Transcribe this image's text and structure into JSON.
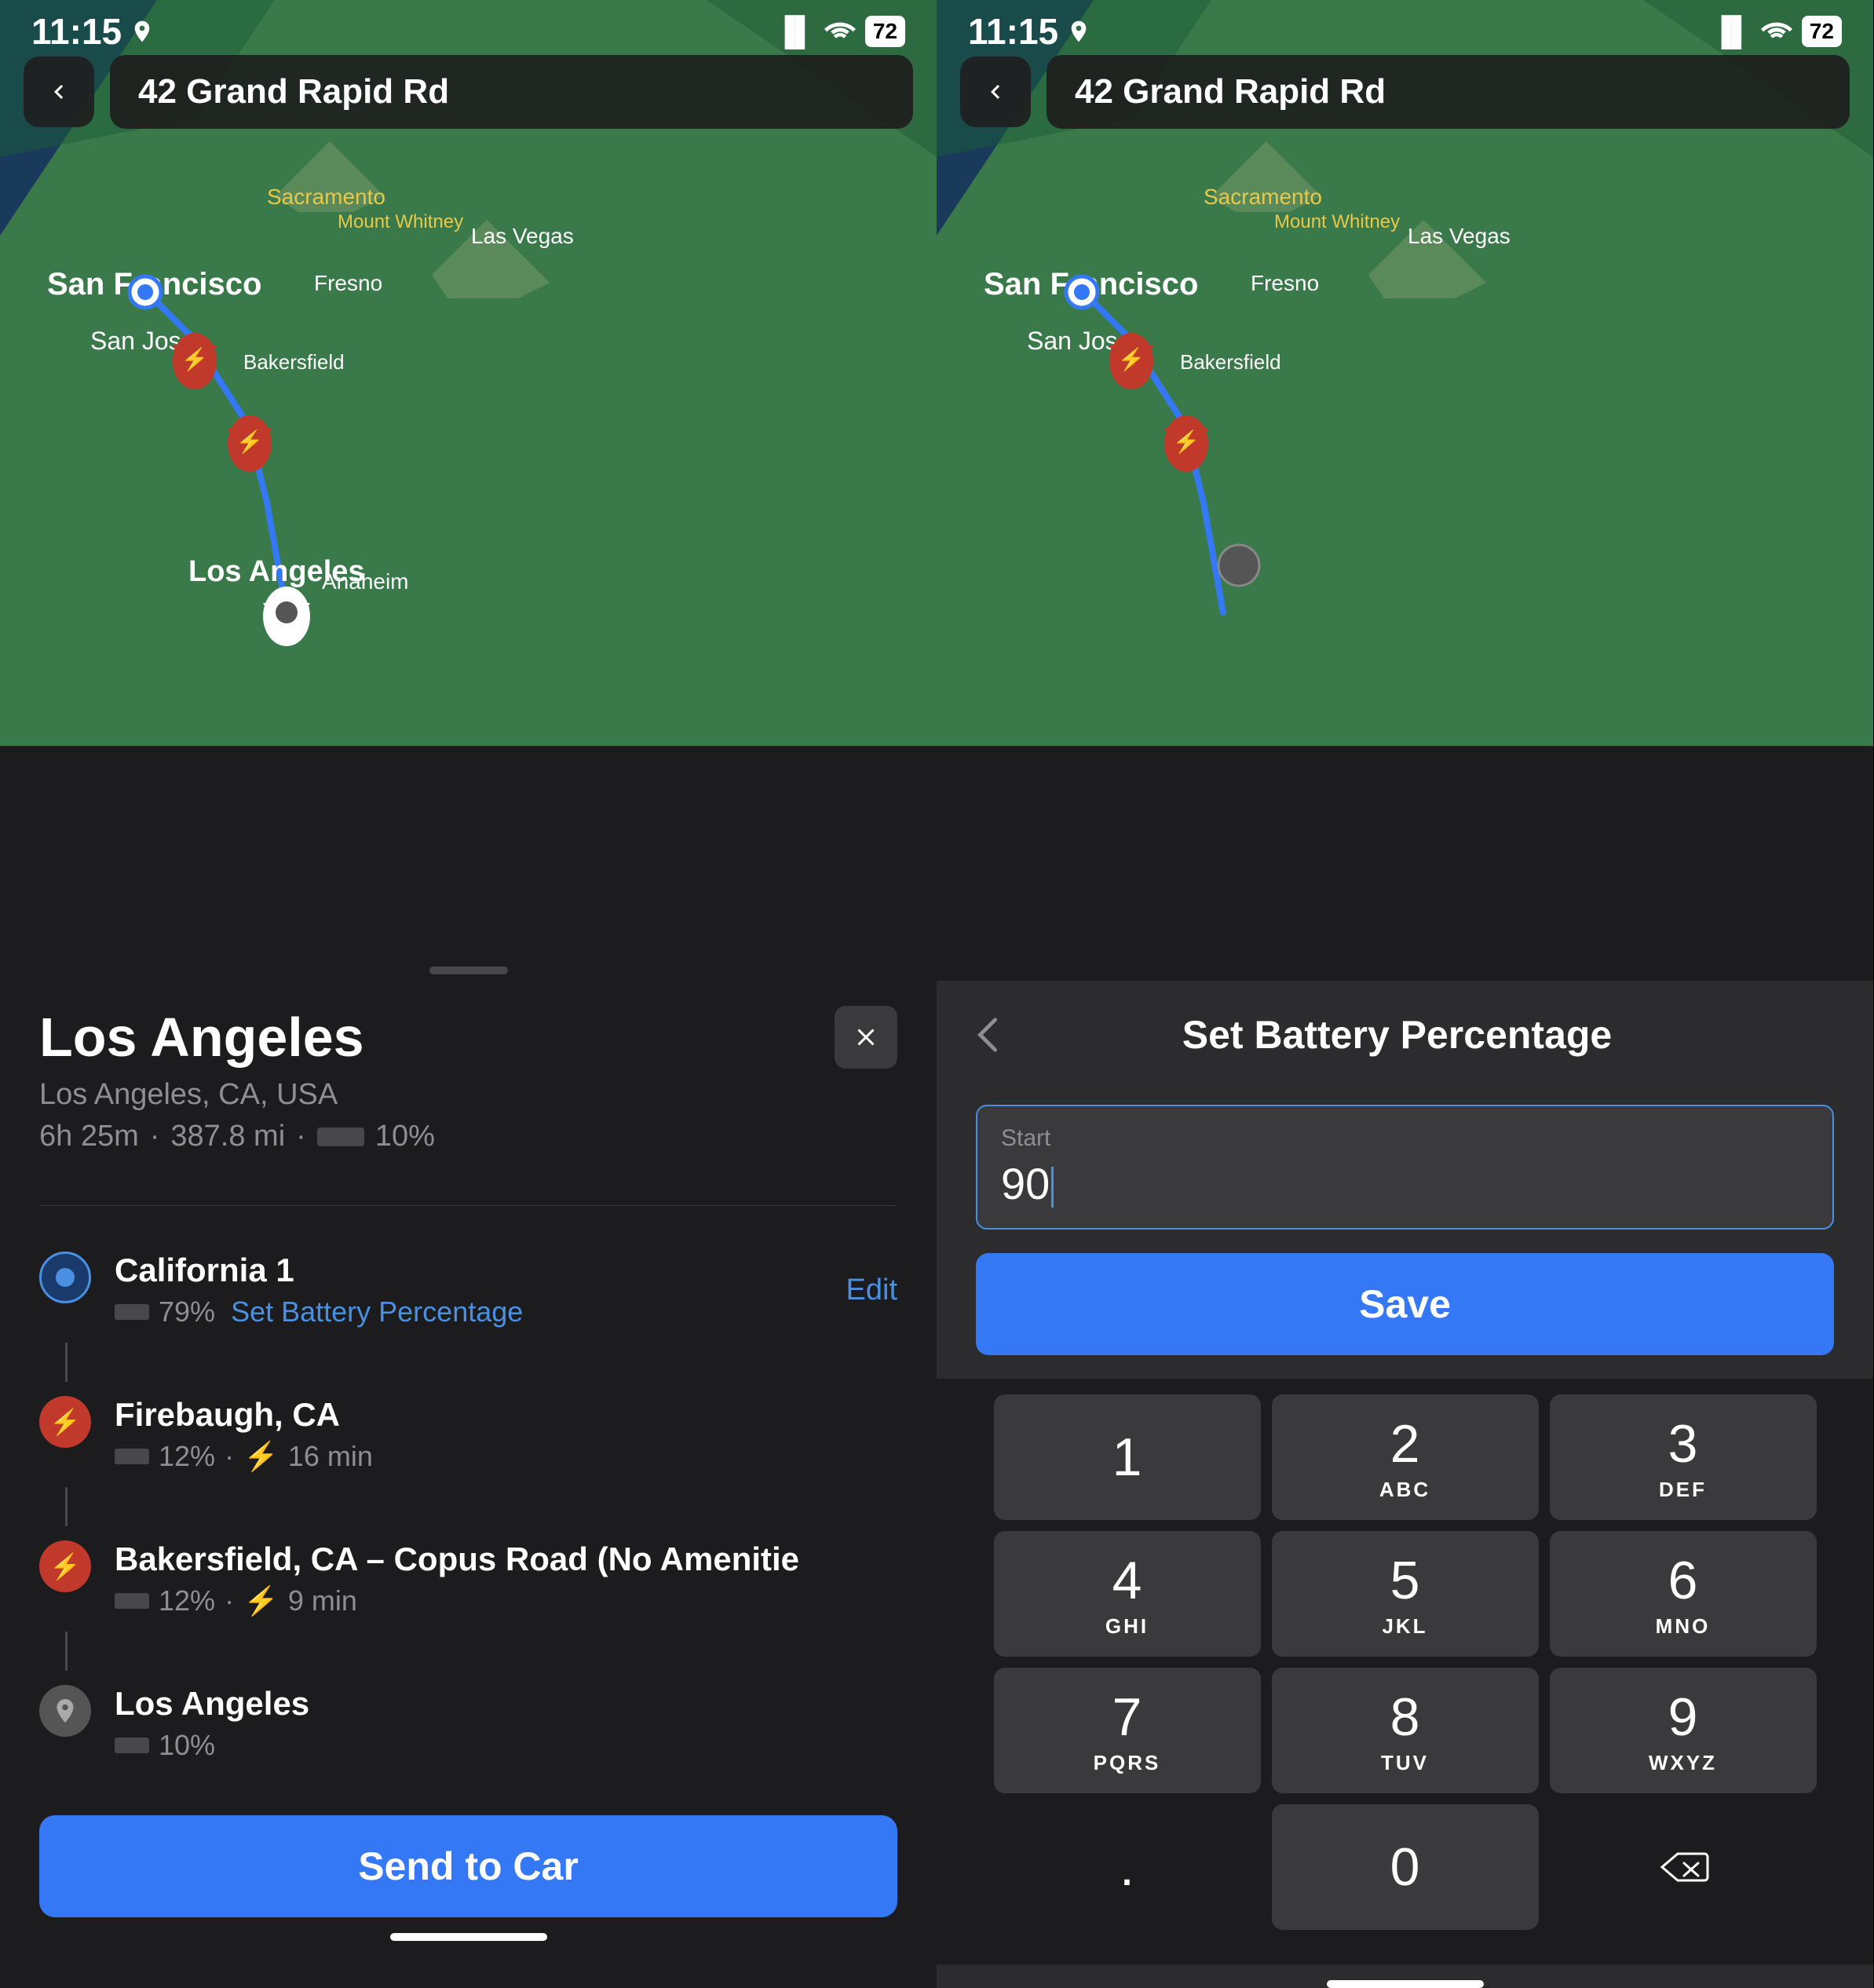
{
  "left_panel": {
    "status_bar": {
      "time": "11:15",
      "battery": "72"
    },
    "nav": {
      "back_label": "‹",
      "address": "42 Grand Rapid Rd"
    },
    "destination": {
      "title": "Los Angeles",
      "subtitle": "Los Angeles, CA, USA",
      "trip_duration": "6h 25m",
      "trip_distance": "387.8 mi",
      "trip_battery": "10%"
    },
    "route_stops": [
      {
        "id": "stop-1",
        "name": "California 1",
        "battery_pct": "79%",
        "set_battery_label": "Set Battery Percentage",
        "type": "origin",
        "edit_label": "Edit"
      },
      {
        "id": "stop-2",
        "name": "Firebaugh, CA",
        "battery_pct": "12%",
        "charge_time": "16 min",
        "type": "charger"
      },
      {
        "id": "stop-3",
        "name": "Bakersfield, CA – Copus Road (No Amenitie",
        "battery_pct": "12%",
        "charge_time": "9 min",
        "type": "charger"
      },
      {
        "id": "stop-4",
        "name": "Los Angeles",
        "battery_pct": "10%",
        "type": "dest"
      }
    ],
    "send_to_car_label": "Send to Car"
  },
  "right_panel": {
    "status_bar": {
      "time": "11:15",
      "battery": "72"
    },
    "nav": {
      "back_label": "‹",
      "address": "42 Grand Rapid Rd"
    },
    "battery_sheet": {
      "back_label": "‹",
      "title": "Set Battery Percentage",
      "input_label": "Start",
      "input_value": "90",
      "save_label": "Save"
    },
    "keypad": {
      "rows": [
        [
          {
            "main": "1",
            "sub": ""
          },
          {
            "main": "2",
            "sub": "ABC"
          },
          {
            "main": "3",
            "sub": "DEF"
          }
        ],
        [
          {
            "main": "4",
            "sub": "GHI"
          },
          {
            "main": "5",
            "sub": "JKL"
          },
          {
            "main": "6",
            "sub": "MNO"
          }
        ],
        [
          {
            "main": "7",
            "sub": "PQRS"
          },
          {
            "main": "8",
            "sub": "TUV"
          },
          {
            "main": "9",
            "sub": "WXYZ"
          }
        ],
        [
          {
            "main": ".",
            "sub": "",
            "type": "dot"
          },
          {
            "main": "0",
            "sub": "",
            "type": "zero"
          },
          {
            "main": "⌫",
            "sub": "",
            "type": "delete"
          }
        ]
      ]
    }
  }
}
